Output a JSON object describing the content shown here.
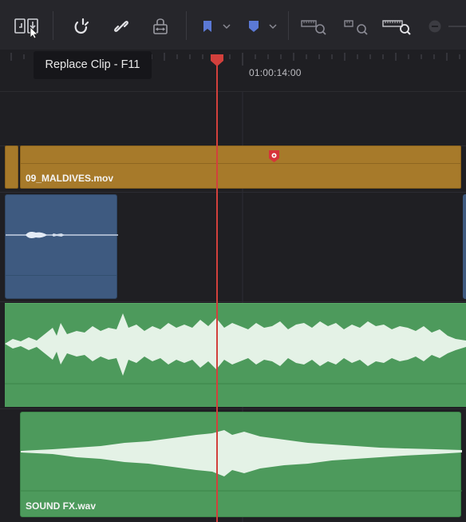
{
  "toolbar": {
    "buttons": [
      {
        "name": "replace-clip-icon"
      },
      {
        "name": "snapping-icon"
      },
      {
        "name": "linked-selection-icon"
      },
      {
        "name": "position-lock-icon"
      },
      {
        "name": "flag-icon"
      },
      {
        "name": "flag-dropdown-icon"
      },
      {
        "name": "marker-icon"
      },
      {
        "name": "marker-dropdown-icon"
      },
      {
        "name": "zoom-full-icon"
      },
      {
        "name": "zoom-detail-icon"
      },
      {
        "name": "zoom-custom-icon"
      },
      {
        "name": "zoom-out-icon"
      }
    ],
    "tooltip": "Replace Clip - F11"
  },
  "ruler": {
    "timecode": "01:00:14:00"
  },
  "tracks": {
    "video_clip": {
      "label": "09_MALDIVES.mov",
      "color": "#a77a2a"
    },
    "audio_clip_1": {
      "color": "#3e5a80"
    },
    "audio_clip_2": {
      "color": "#4d9a5c"
    },
    "audio_clip_3": {
      "label": "SOUND FX.wav",
      "color": "#4d9a5c"
    }
  },
  "playhead": {
    "color": "#d2403c"
  }
}
